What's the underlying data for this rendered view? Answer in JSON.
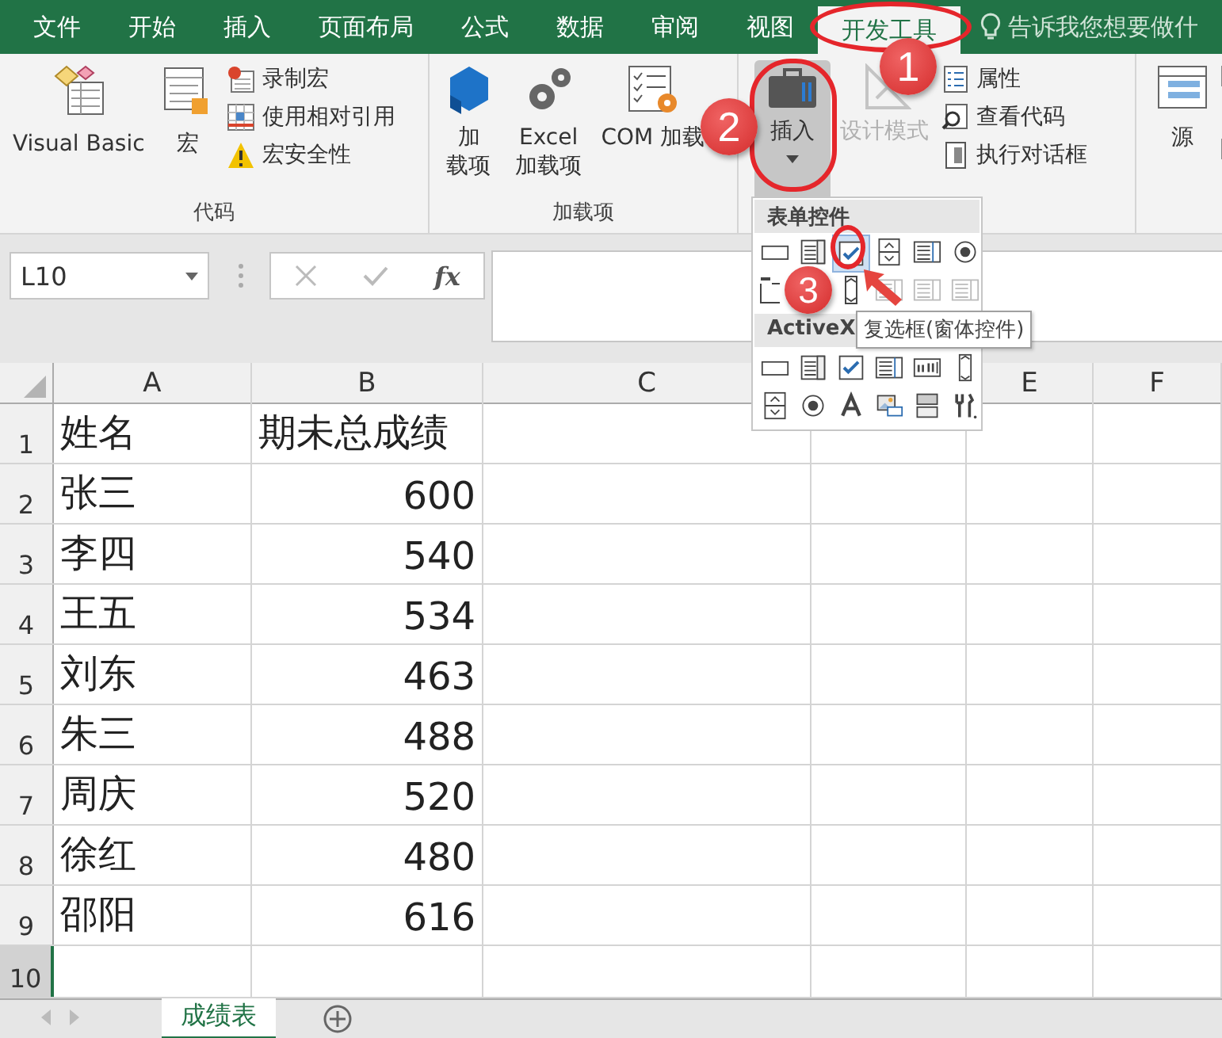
{
  "tabs": [
    {
      "label": "文件",
      "selected": false
    },
    {
      "label": "开始",
      "selected": false
    },
    {
      "label": "插入",
      "selected": false
    },
    {
      "label": "页面布局",
      "selected": false
    },
    {
      "label": "公式",
      "selected": false
    },
    {
      "label": "数据",
      "selected": false
    },
    {
      "label": "审阅",
      "selected": false
    },
    {
      "label": "视图",
      "selected": false
    },
    {
      "label": "开发工具",
      "selected": true
    }
  ],
  "tell_me": {
    "placeholder": "告诉我您想要做什"
  },
  "ribbon": {
    "code_group": {
      "title": "代码",
      "large": [
        "Visual Basic",
        "宏"
      ],
      "small": [
        "录制宏",
        "使用相对引用",
        "宏安全性"
      ]
    },
    "addins_group": {
      "title": "加载项",
      "large": [
        {
          "label": "加载项"
        },
        {
          "label": "Excel 加载项"
        },
        {
          "label": "COM 加载"
        }
      ]
    },
    "controls_group": {
      "insert": {
        "label": "插入",
        "pressed": true
      },
      "design_mode": {
        "label": "设计模式",
        "disabled": true
      },
      "small": [
        "属性",
        "查看代码",
        "执行对话框"
      ]
    },
    "xml_group": {
      "source": "源"
    }
  },
  "formula_bar": {
    "name_box": "L10",
    "fx": "fx"
  },
  "columns": [
    "A",
    "B",
    "C",
    "E",
    "F"
  ],
  "rows": [
    {
      "number": "1",
      "name": "姓名",
      "score": "期未总成绩",
      "active": false
    },
    {
      "number": "2",
      "name": "张三",
      "score": "600",
      "active": false
    },
    {
      "number": "3",
      "name": "李四",
      "score": "540",
      "active": false
    },
    {
      "number": "4",
      "name": "王五",
      "score": "534",
      "active": false
    },
    {
      "number": "5",
      "name": "刘东",
      "score": "463",
      "active": false
    },
    {
      "number": "6",
      "name": "朱三",
      "score": "488",
      "active": false
    },
    {
      "number": "7",
      "name": "周庆",
      "score": "520",
      "active": false
    },
    {
      "number": "8",
      "name": "徐红",
      "score": "480",
      "active": false
    },
    {
      "number": "9",
      "name": "邵阳",
      "score": "616",
      "active": false
    },
    {
      "number": "10",
      "active": true
    }
  ],
  "sheet_tabs": [
    {
      "label": "成绩表",
      "selected": true
    }
  ],
  "insert_menu": {
    "form_title": "表单控件",
    "form_controls": [
      {
        "kind": "button",
        "disabled": false,
        "selected": false
      },
      {
        "kind": "combo",
        "disabled": false,
        "selected": false
      },
      {
        "kind": "checkbox",
        "disabled": false,
        "selected": true
      },
      {
        "kind": "spin",
        "disabled": false,
        "selected": false
      },
      {
        "kind": "listbox",
        "disabled": false,
        "selected": false
      },
      {
        "kind": "option",
        "disabled": false,
        "selected": false
      }
    ],
    "form_controls_row2": [
      {
        "kind": "groupbox",
        "disabled": false
      },
      {
        "kind": "scrollbar",
        "disabled": false
      },
      {
        "kind": "listbox",
        "disabled": true
      },
      {
        "kind": "listbox",
        "disabled": true
      },
      {
        "kind": "listbox",
        "disabled": true
      }
    ],
    "activex_title": "ActiveX",
    "activex_controls": [
      {
        "kind": "button"
      },
      {
        "kind": "combo"
      },
      {
        "kind": "checkbox"
      },
      {
        "kind": "listbox"
      },
      {
        "kind": "textbox"
      },
      {
        "kind": "scrollbar"
      },
      {
        "kind": "spin"
      },
      {
        "kind": "option"
      },
      {
        "kind": "label"
      },
      {
        "kind": "image"
      },
      {
        "kind": "toggle"
      },
      {
        "kind": "more"
      }
    ]
  },
  "tooltip": "复选框(窗体控件)",
  "annotations": [
    {
      "number": "1"
    },
    {
      "number": "2"
    },
    {
      "number": "3"
    }
  ]
}
